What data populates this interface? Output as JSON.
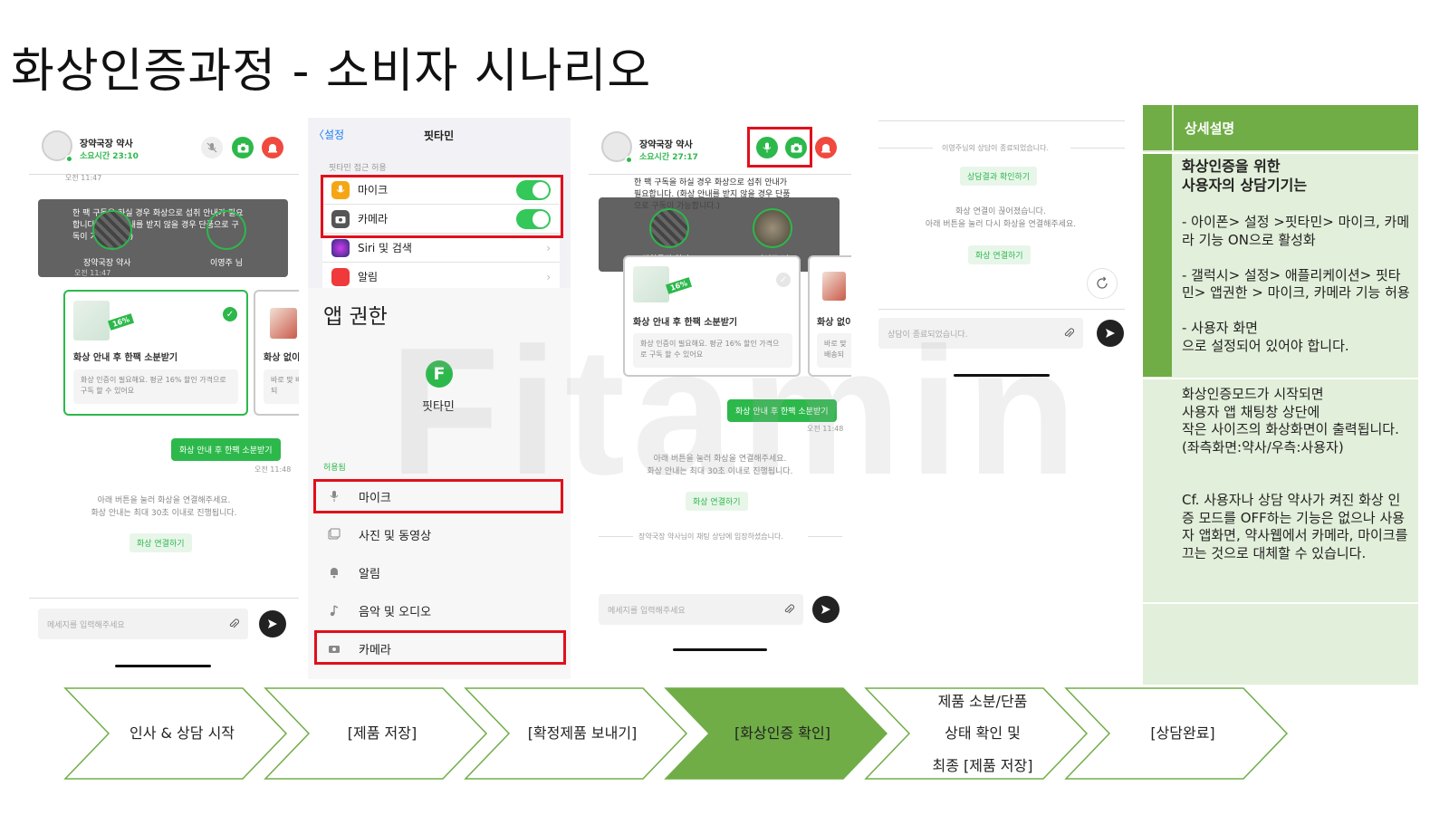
{
  "title": "화상인증과정 - 소비자 시나리오",
  "watermark": "Fitamin",
  "phone1": {
    "pharmacist_name": "장약국장 약사",
    "elapsed": "소요시간 23:10",
    "time_top": "오전 11:47",
    "overlay_text": "한 팩 구독을 하실 경우 화상으로 섭취 안내가 필요합니다. (화상 안내를 받지 않을 경우 단품으로 구독이 가능합니다.)",
    "overlay_time": "오전 11:47",
    "video_left_label": "장약국장 약사",
    "video_right_label": "이영주 님",
    "card1_title": "화상 안내 후 한팩 소분받기",
    "card1_desc": "화상 인증이 필요해요. 평균 16% 할인 가격으로 구독 할 수 있어요",
    "card2_title": "화상 없이",
    "card2_desc": "바로 맞 배송되",
    "badge": "16%",
    "bubble": "화상 안내 후 한팩 소분받기",
    "bubble_time": "오전 11:48",
    "notice": "아래 버튼을 눌러 화상을 연결해주세요.\n화상 안내는 최대 30초 이내로 진행됩니다.",
    "connect_btn": "화상 연결하기",
    "input_placeholder": "메세지를 입력해주세요"
  },
  "phone2": {
    "back": "설정",
    "nav_title": "핏타민",
    "section": "핏타민 접근 허용",
    "rows": [
      "마이크",
      "카메라",
      "Siri 및 검색",
      "알림"
    ],
    "app_perm_title": "앱 권한",
    "app_name": "핏타민",
    "app_logo": "F",
    "allowed_section": "허용됨",
    "perm_rows": [
      "마이크",
      "사진 및 동영상",
      "알림",
      "음악 및 오디오",
      "카메라"
    ]
  },
  "phone3": {
    "pharmacist_name": "장약국장 약사",
    "elapsed": "소요시간 27:17",
    "msg_text": "한 팩 구독을 하실 경우 화상으로 섭취 안내가 필요합니다. (화상 안내를 받지 않을 경우 단품으로 구독이 가능합니다.)",
    "video_left_label": "장약국장 약사",
    "video_right_label": "이영주 님",
    "card1_title": "화상 안내 후 한팩 소분받기",
    "card1_desc": "화상 인증이 필요해요. 평균 16% 할인 가격으로 구독 할 수 있어요",
    "card2_title": "화상 없이",
    "card2_desc": "바로 맞 배송되",
    "badge": "16%",
    "bubble": "화상 안내 후 한팩 소분받기",
    "bubble_time": "오전 11:48",
    "notice": "아래 버튼을 눌러 화상을 연결해주세요.\n화상 안내는 최대 30초 이내로 진행됩니다.",
    "connect_btn": "화상 연결하기",
    "entered": "장약국장 약사님이 채팅 상담에 입장하셨습니다.",
    "input_placeholder": "메세지를 입력해주세요"
  },
  "phone4": {
    "ended": "이영주님의 상담이 종료되었습니다.",
    "result_btn": "상담결과 확인하기",
    "disconnected": "화상 연결이 끊어졌습니다.\n아래 버튼을 눌러 다시 화상을 연결해주세요.",
    "connect_btn": "화상 연결하기",
    "input_placeholder": "상담이 종료되었습니다."
  },
  "description": {
    "header": "상세설명",
    "block1_title": "화상인증을 위한\n사용자의 상담기기는",
    "block1_body": "- 아이폰> 설정 >핏타민> 마이크, 카메라 기능 ON으로 활성화\n\n- 갤럭시> 설정> 애플리케이션> 핏타민> 앱권한 > 마이크, 카메라 기능 허용\n\n- 사용자 화면\n으로 설정되어 있어야 합니다.",
    "block2_body": "화상인증모드가 시작되면\n사용자 앱 채팅창 상단에\n작은 사이즈의 화상화면이 출력됩니다.\n(좌측화면:약사/우측:사용자)\n\n\nCf. 사용자나 상담 약사가 켜진 화상 인증 모드를 OFF하는 기능은 없으나 사용자 앱화면, 약사웹에서 카메라, 마이크를 끄는 것으로 대체할 수 있습니다."
  },
  "flow": {
    "steps": [
      "인사 & 상담 시작",
      "[제품 저장]",
      "[확정제품 보내기]",
      "[화상인증 확인]",
      "제품 소분/단품\n상태 확인 및\n최종 [제품 저장]",
      "[상담완료]"
    ],
    "active_index": 3,
    "active_color": "#70ad47",
    "border_color": "#70ad47"
  },
  "colors": {
    "brand_green": "#2db84b",
    "highlight_red": "#e0101c",
    "alert_red": "#f0493e"
  }
}
